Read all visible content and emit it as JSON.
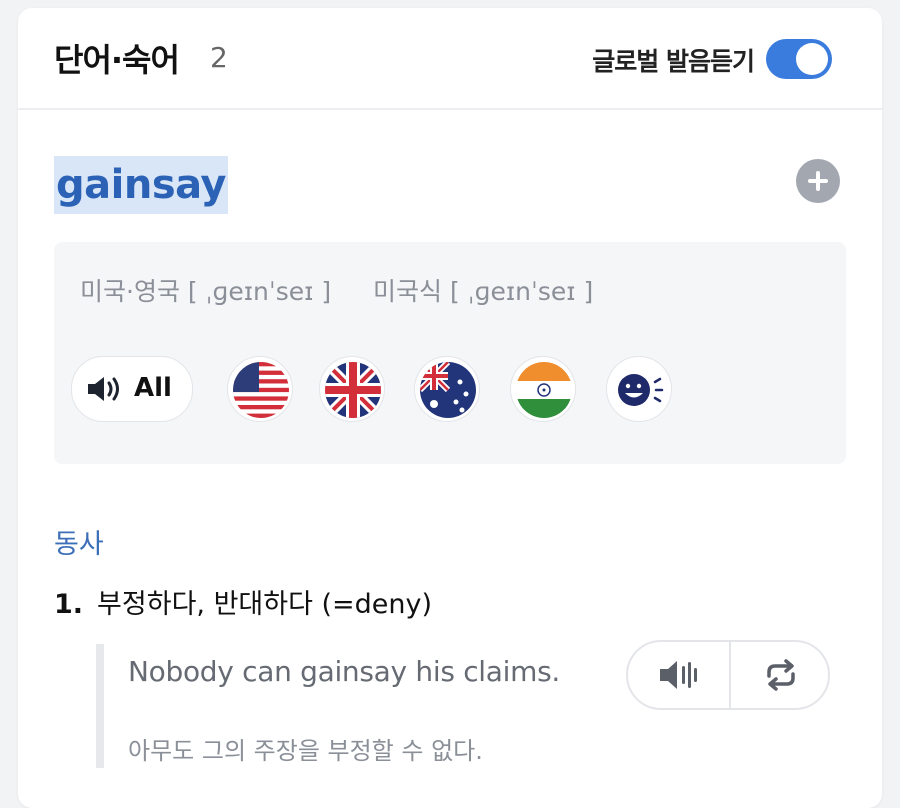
{
  "header": {
    "title": "단어·숙어",
    "count": "2",
    "global_pronunciation_label": "글로벌 발음듣기",
    "global_pronunciation_enabled": true
  },
  "entry": {
    "headword": "gainsay",
    "pronunciation": {
      "us_uk_label": "미국·영국",
      "us_uk_ipa": "[ ˌɡeɪnˈseɪ ]",
      "american_label": "미국식",
      "american_ipa": "[ ˌɡeɪnˈseɪ ]"
    },
    "audio": {
      "all_label": "All",
      "flags": [
        "us-flag",
        "uk-flag",
        "australia-flag",
        "india-flag",
        "voice-face"
      ]
    },
    "part_of_speech": "동사",
    "senses": [
      {
        "number": "1.",
        "meaning": "부정하다, 반대하다 (=deny)",
        "example_en": "Nobody can gainsay his claims.",
        "example_ko": "아무도 그의 주장을 부정할 수 없다."
      }
    ]
  },
  "colors": {
    "accent": "#3a7bde",
    "headword": "#2b62b6",
    "headword_highlight": "#d9e6f7",
    "pos": "#3d6fb8"
  }
}
